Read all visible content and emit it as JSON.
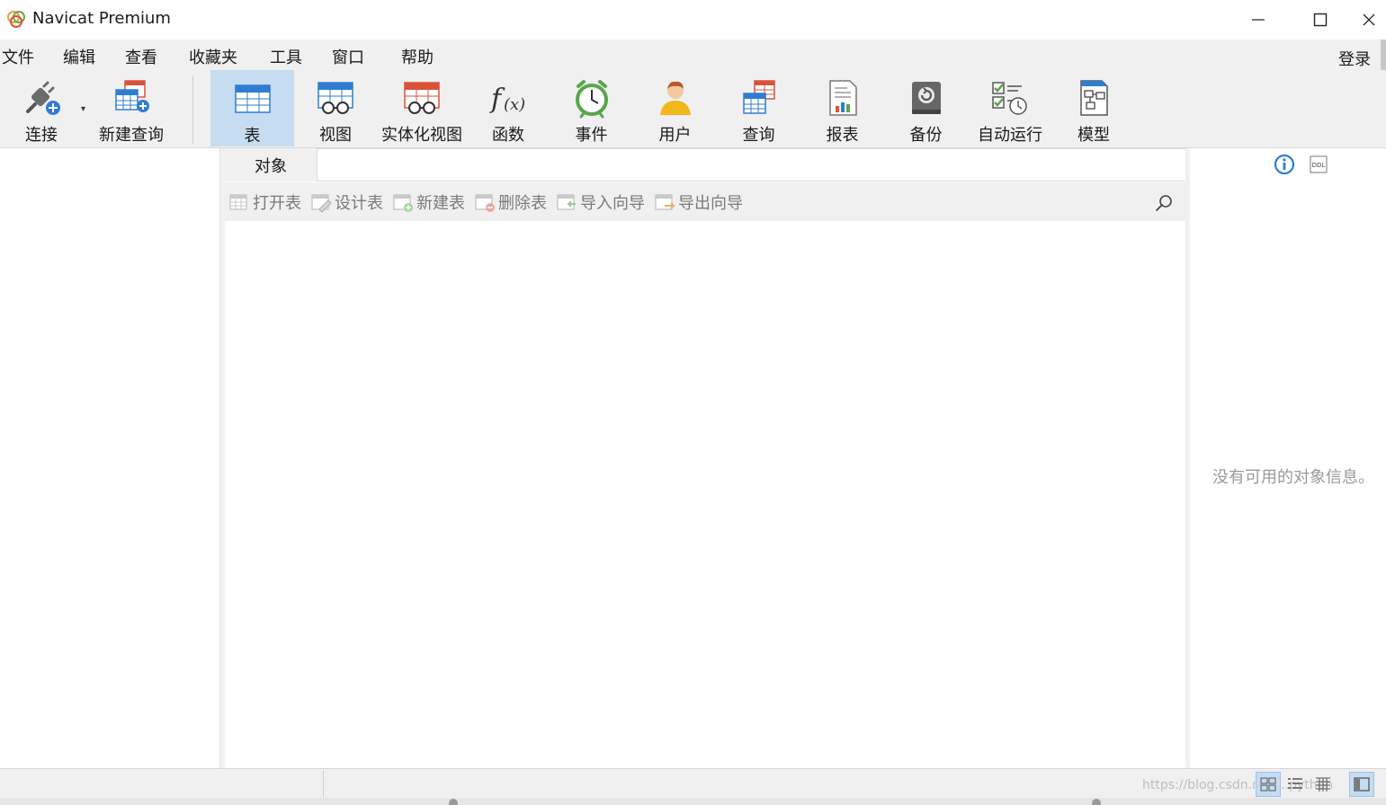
{
  "window": {
    "title": "Navicat Premium"
  },
  "menu": {
    "items": [
      "文件",
      "编辑",
      "查看",
      "收藏夹",
      "工具",
      "窗口",
      "帮助"
    ],
    "login_label": "登录"
  },
  "toolbar": {
    "connect_label": "连接",
    "new_query_label": "新建查询",
    "table_label": "表",
    "view_label": "视图",
    "materialized_view_label": "实体化视图",
    "function_label": "函数",
    "event_label": "事件",
    "user_label": "用户",
    "query_label": "查询",
    "report_label": "报表",
    "backup_label": "备份",
    "automation_label": "自动运行",
    "model_label": "模型",
    "active_tool": "表"
  },
  "center": {
    "objects_tab_label": "对象",
    "actions": {
      "open_table": "打开表",
      "design_table": "设计表",
      "new_table": "新建表",
      "delete_table": "删除表",
      "import_wizard": "导入向导",
      "export_wizard": "导出向导"
    }
  },
  "info_pane": {
    "empty_message": "没有可用的对象信息。",
    "ddl_label": "DDL"
  },
  "status": {
    "watermark": "https://blog.csdn.net/...python"
  },
  "colors": {
    "accent_blue": "#2f7dd1",
    "active_tool_bg": "#c6dcf0",
    "chrome_bg": "#f0f0f0",
    "table_red": "#d9533b"
  }
}
